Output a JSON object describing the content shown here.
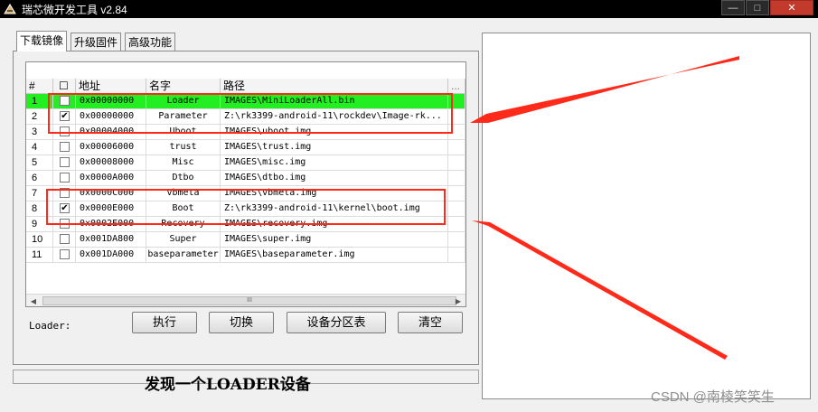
{
  "window": {
    "title": "瑞芯微开发工具 v2.84",
    "buttons": {
      "minimize": "—",
      "maximize": "□",
      "close": "✕"
    }
  },
  "tabs": [
    {
      "label": "下载镜像",
      "active": true
    },
    {
      "label": "升级固件",
      "active": false
    },
    {
      "label": "高级功能",
      "active": false
    }
  ],
  "grid": {
    "headers": {
      "num": "#",
      "check": "☐",
      "address": "地址",
      "name": "名字",
      "path": "路径",
      "extra": "..."
    },
    "rows": [
      {
        "num": "1",
        "checked": false,
        "address": "0x00000000",
        "name": "Loader",
        "path": "IMAGES\\MiniLoaderAll.bin"
      },
      {
        "num": "2",
        "checked": true,
        "address": "0x00000000",
        "name": "Parameter",
        "path": "Z:\\rk3399-android-11\\rockdev\\Image-rk..."
      },
      {
        "num": "3",
        "checked": false,
        "address": "0x00004000",
        "name": "Uboot",
        "path": "IMAGES\\uboot.img"
      },
      {
        "num": "4",
        "checked": false,
        "address": "0x00006000",
        "name": "trust",
        "path": "IMAGES\\trust.img"
      },
      {
        "num": "5",
        "checked": false,
        "address": "0x00008000",
        "name": "Misc",
        "path": "IMAGES\\misc.img"
      },
      {
        "num": "6",
        "checked": false,
        "address": "0x0000A000",
        "name": "Dtbo",
        "path": "IMAGES\\dtbo.img"
      },
      {
        "num": "7",
        "checked": false,
        "address": "0x0000C000",
        "name": "vbmeta",
        "path": "IMAGES\\vbmeta.img"
      },
      {
        "num": "8",
        "checked": true,
        "address": "0x0000E000",
        "name": "Boot",
        "path": "Z:\\rk3399-android-11\\kernel\\boot.img"
      },
      {
        "num": "9",
        "checked": false,
        "address": "0x0002E000",
        "name": "Recovery",
        "path": "IMAGES\\recovery.img"
      },
      {
        "num": "10",
        "checked": false,
        "address": "0x001DA800",
        "name": "Super",
        "path": "IMAGES\\super.img"
      },
      {
        "num": "11",
        "checked": false,
        "address": "0x001DA000",
        "name": "baseparameter",
        "path": "IMAGES\\baseparameter.img"
      }
    ],
    "scroll_thumb": "III"
  },
  "loader_label": "Loader:",
  "actions": {
    "execute": "执行",
    "switch": "切换",
    "partition_table": "设备分区表",
    "clear": "清空"
  },
  "status_text": "发现一个LOADER设备",
  "watermark": "CSDN @南棱笑笑生",
  "annotation_colors": {
    "highlight": "#ff2a1a",
    "loader_row": "#22ee22"
  }
}
